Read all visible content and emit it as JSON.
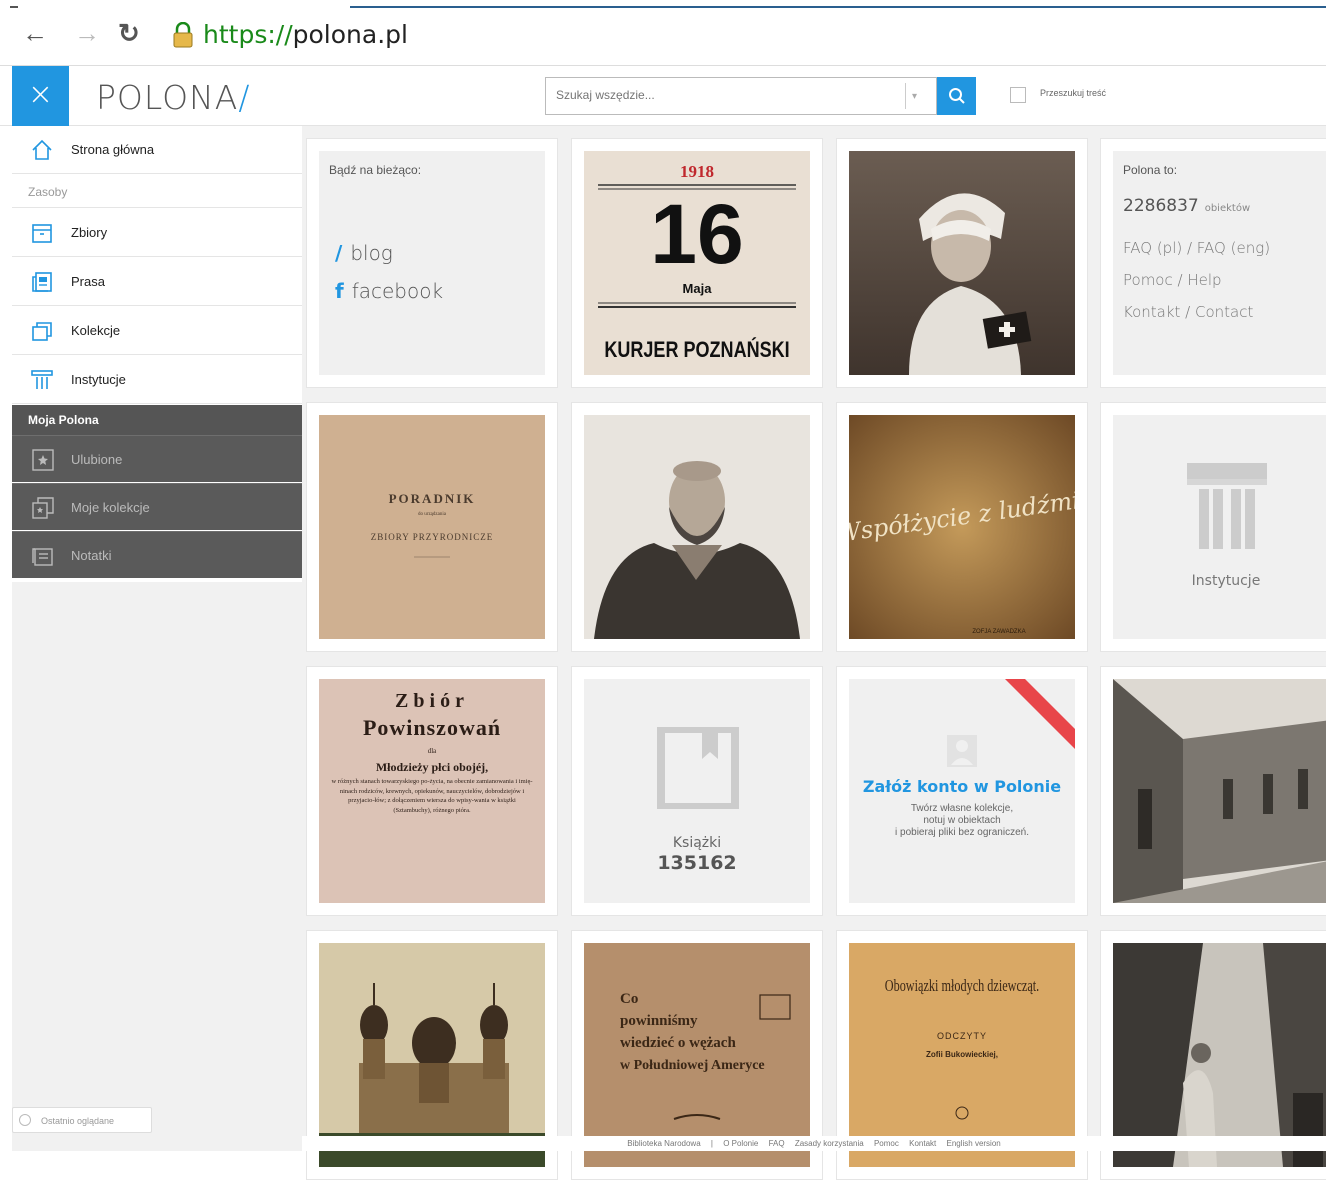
{
  "browser": {
    "url_proto": "https://",
    "url_host": "polona.pl"
  },
  "header": {
    "logo_text": "POLONA",
    "logo_slash": "/",
    "close_glyph": "×",
    "search_placeholder": "Szukaj wszędzie...",
    "fulltext_label": "Przeszukuj treść"
  },
  "sidebar": {
    "home_label": "Strona główna",
    "section_label": "Zasoby",
    "items": [
      {
        "label": "Zbiory",
        "icon": "box-icon"
      },
      {
        "label": "Prasa",
        "icon": "newspaper-icon"
      },
      {
        "label": "Kolekcje",
        "icon": "collections-icon"
      },
      {
        "label": "Instytucje",
        "icon": "institution-icon"
      }
    ],
    "moja_header": "Moja Polona",
    "moja_items": [
      {
        "label": "Ulubione",
        "icon": "star-icon"
      },
      {
        "label": "Moje kolekcje",
        "icon": "collections-icon"
      },
      {
        "label": "Notatki",
        "icon": "notes-icon"
      }
    ],
    "recent_label": "Ostatnio oglądane"
  },
  "tiles": {
    "news": {
      "title": "Bądź na bieżąco:",
      "blog": "blog",
      "facebook": "facebook"
    },
    "poster_1918": {
      "year": "1918",
      "day": "16",
      "month": "Maja",
      "name": "KURJER POZNAŃSKI"
    },
    "polona_to": {
      "title": "Polona to:",
      "count": "2286837",
      "count_unit": "obiektów",
      "faq": "FAQ (pl) / FAQ (eng)",
      "help": "Pomoc / Help",
      "contact": "Kontakt / Contact"
    },
    "poradnik": {
      "line1": "PORADNIK",
      "line2": "do urządzania",
      "line3": "ZBIORY PRZYRODNICZE"
    },
    "wspolzycie": {
      "script": "Współżycie z ludźmi",
      "footer": "ZOFJA ZAWADZKA"
    },
    "instytucje": {
      "label": "Instytucje"
    },
    "zbior": {
      "line1": "Zbiór",
      "line2": "Powinszowań",
      "line3": "dla",
      "line4": "Młodzieży płci obojéj,",
      "body": "w różnych stanach towarzyskiego po-życia, na obecnie zamianowania i imię-ninach rodziców, krewnych, opiekunów, nauczycielów, dobrodziejów i przyjacio-łów; z dołączeniem wiersza do wpisy-wania w książki (Sztambuchy), różnego pióra."
    },
    "ksiazki": {
      "label": "Książki",
      "count": "135162"
    },
    "konto": {
      "title": "Załóż konto w Polonie",
      "desc1": "Twórz własne kolekcje,",
      "desc2": "notuj w obiektach",
      "desc3": "i pobieraj pliki bez ograniczeń."
    },
    "weze": {
      "line1": "Co",
      "line2": "powinniśmy",
      "line3": "wiedzieć o wężach",
      "line4": "w Południowej Ameryce"
    },
    "obowiazki": {
      "line1": "Obowiązki młodych dziewcząt.",
      "line2": "ODCZYTY",
      "line3": "Zofii Bukowieckiej,"
    }
  },
  "footer": {
    "links": [
      "Biblioteka Narodowa",
      "|",
      "O Polonie",
      "FAQ",
      "Zasady korzystania",
      "Pomoc",
      "Kontakt",
      "English version"
    ]
  },
  "colors": {
    "accent": "#2196e0",
    "sidebar_dark": "#5a5a5a",
    "ribbon": "#e8454a"
  }
}
